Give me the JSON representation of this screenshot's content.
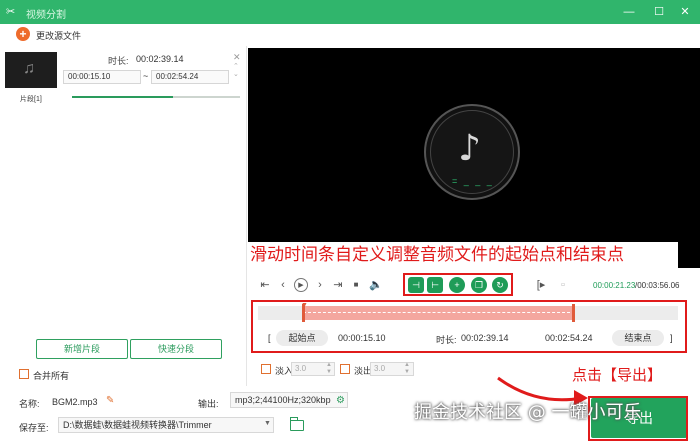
{
  "window": {
    "title": "视频分割",
    "controls": [
      "—",
      "☐",
      "✕"
    ]
  },
  "toolbar": {
    "change_file_label": "更改源文件"
  },
  "segment": {
    "duration_label": "时长:",
    "duration_value": "00:02:39.14",
    "start": "00:00:15.10",
    "end": "00:02:54.24",
    "separator": "~",
    "name": "片段[1]",
    "progress": 0.6
  },
  "left_buttons": {
    "add_segment": "新增片段",
    "quick_split": "快速分段",
    "merge_all": "合并所有"
  },
  "annotation_top": "滑动时间条自定义调整音频文件的起始点和结束点",
  "player": {
    "current_time": "00:00:21.23",
    "total_time": "/00:03:56.06",
    "eq_glyph": "= _ _ _"
  },
  "range": {
    "start_bracket": "[",
    "start_label": "起始点",
    "start_value": "00:00:15.10",
    "duration_label": "时长:",
    "duration_value": "00:02:39.14",
    "end_value": "00:02:54.24",
    "end_label": "结束点",
    "end_bracket": "]"
  },
  "fade": {
    "in_label": "淡入",
    "in_value": "3.0",
    "out_label": "淡出",
    "out_value": "3.0"
  },
  "bottom": {
    "name_label": "名称:",
    "name_value": "BGM2.mp3",
    "output_label": "输出:",
    "output_value": "mp3;2;44100Hz;320kbp",
    "save_label": "保存至:",
    "save_path": "D:\\数据蛙\\数据蛙视频转换器\\Trimmer",
    "export_label": "导出"
  },
  "click_annotation": "点击【导出】",
  "watermark": "掘金技术社区 @ 一罐小可乐",
  "colors": {
    "accent": "#30b56c",
    "annotation": "#e01b1b",
    "selection": "#f4a79f"
  }
}
